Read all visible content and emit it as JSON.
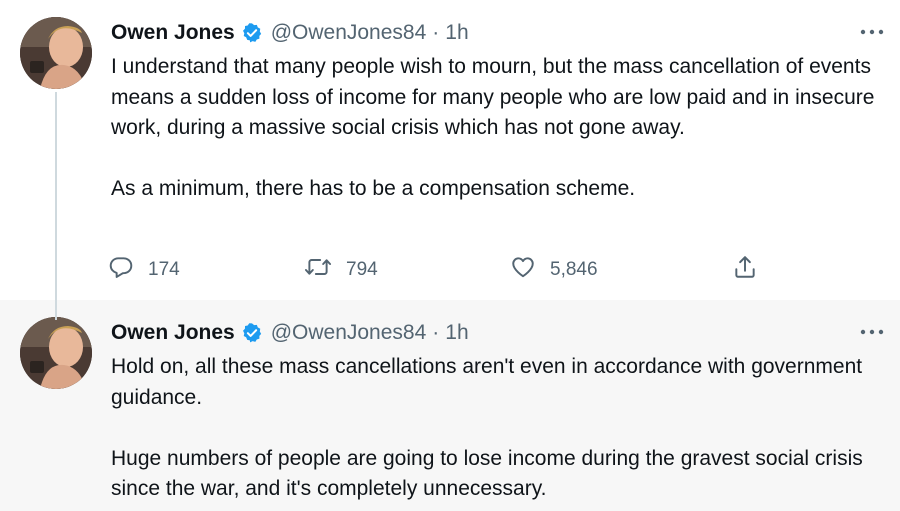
{
  "tweets": [
    {
      "author_name": "Owen Jones",
      "handle": "@OwenJones84",
      "separator": "·",
      "time": "1h",
      "paragraphs": [
        "I understand that many people wish to mourn, but the mass cancellation of events means a sudden loss of income for many people who are low paid and in insecure work, during a massive social crisis which has not gone away.",
        "As a minimum, there has to be a compensation scheme."
      ],
      "replies": "174",
      "retweets": "794",
      "likes": "5,846"
    },
    {
      "author_name": "Owen Jones",
      "handle": "@OwenJones84",
      "separator": "·",
      "time": "1h",
      "paragraphs": [
        "Hold on, all these mass cancellations aren't even in accordance with government guidance.",
        "Huge numbers of people are going to lose income during the gravest social crisis since the war, and it's completely unnecessary."
      ]
    }
  ],
  "colors": {
    "verified": "#1d9bf0",
    "text": "#0f1419",
    "secondary": "#536471",
    "thread_line": "#cfd9de",
    "second_tweet_background": "#f7f7f7"
  },
  "icons": [
    "verified-badge-icon",
    "more-options-icon",
    "reply-icon",
    "retweet-icon",
    "like-icon",
    "share-icon"
  ]
}
